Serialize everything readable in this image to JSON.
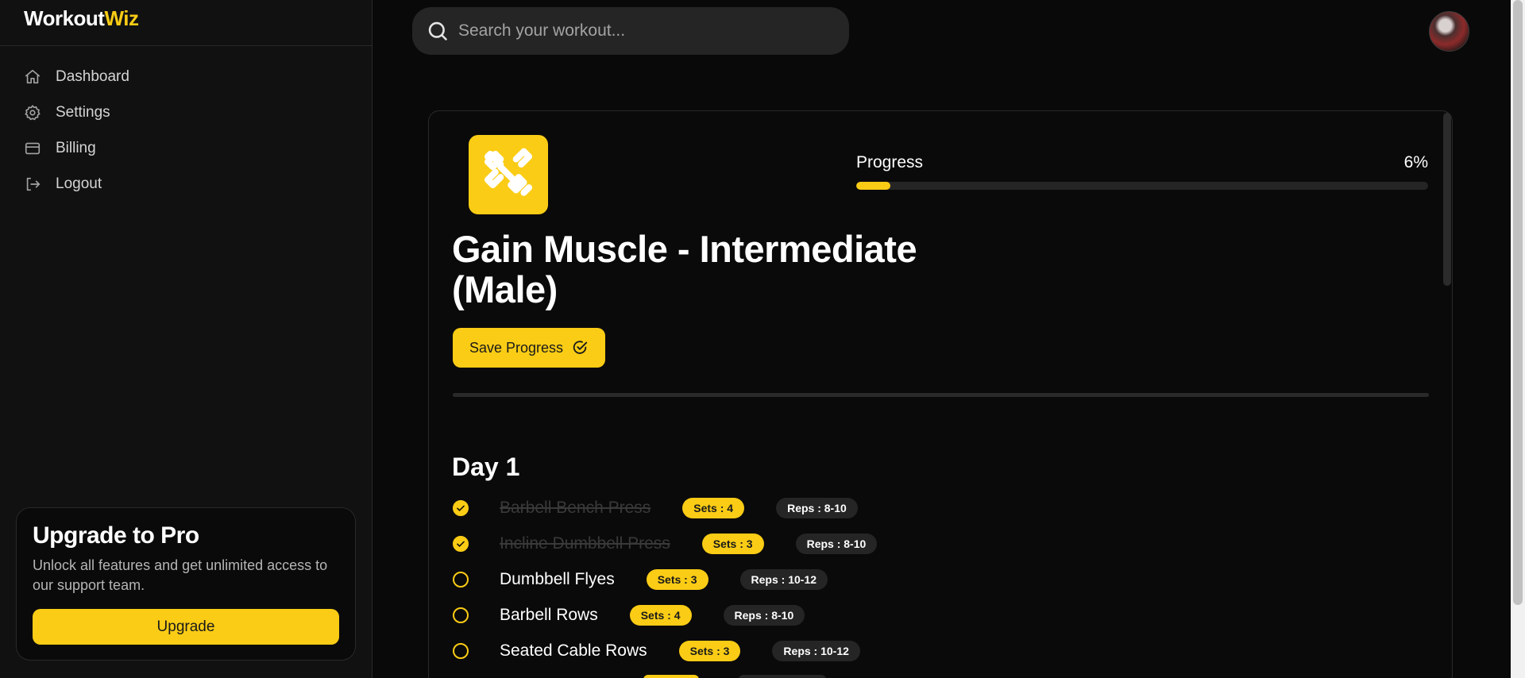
{
  "app": {
    "logo_part1": "Workout",
    "logo_part2": "Wiz"
  },
  "sidebar": {
    "items": [
      {
        "label": "Dashboard",
        "icon": "home-icon"
      },
      {
        "label": "Settings",
        "icon": "gear-icon"
      },
      {
        "label": "Billing",
        "icon": "credit-card-icon"
      },
      {
        "label": "Logout",
        "icon": "logout-icon"
      }
    ],
    "upgrade": {
      "title": "Upgrade to Pro",
      "text": "Unlock all features and get unlimited access to our support team.",
      "button": "Upgrade"
    }
  },
  "search": {
    "placeholder": "Search your workout..."
  },
  "plan": {
    "icon": "dumbbell-icon",
    "title": "Gain Muscle - Intermediate (Male)",
    "save_label": "Save Progress",
    "progress_label": "Progress",
    "progress_value": "6%",
    "progress_fraction": 0.06,
    "day_title": "Day 1",
    "exercises": [
      {
        "name": "Barbell Bench Press",
        "sets": "Sets : 4",
        "reps": "Reps : 8-10",
        "done": true
      },
      {
        "name": "Incline Dumbbell Press",
        "sets": "Sets : 3",
        "reps": "Reps : 8-10",
        "done": true
      },
      {
        "name": "Dumbbell Flyes",
        "sets": "Sets : 3",
        "reps": "Reps : 10-12",
        "done": false
      },
      {
        "name": "Barbell Rows",
        "sets": "Sets : 4",
        "reps": "Reps : 8-10",
        "done": false
      },
      {
        "name": "Seated Cable Rows",
        "sets": "Sets : 3",
        "reps": "Reps : 10-12",
        "done": false
      }
    ]
  },
  "colors": {
    "accent": "#facc15",
    "background": "#0a0909",
    "sidebar": "#121111"
  }
}
